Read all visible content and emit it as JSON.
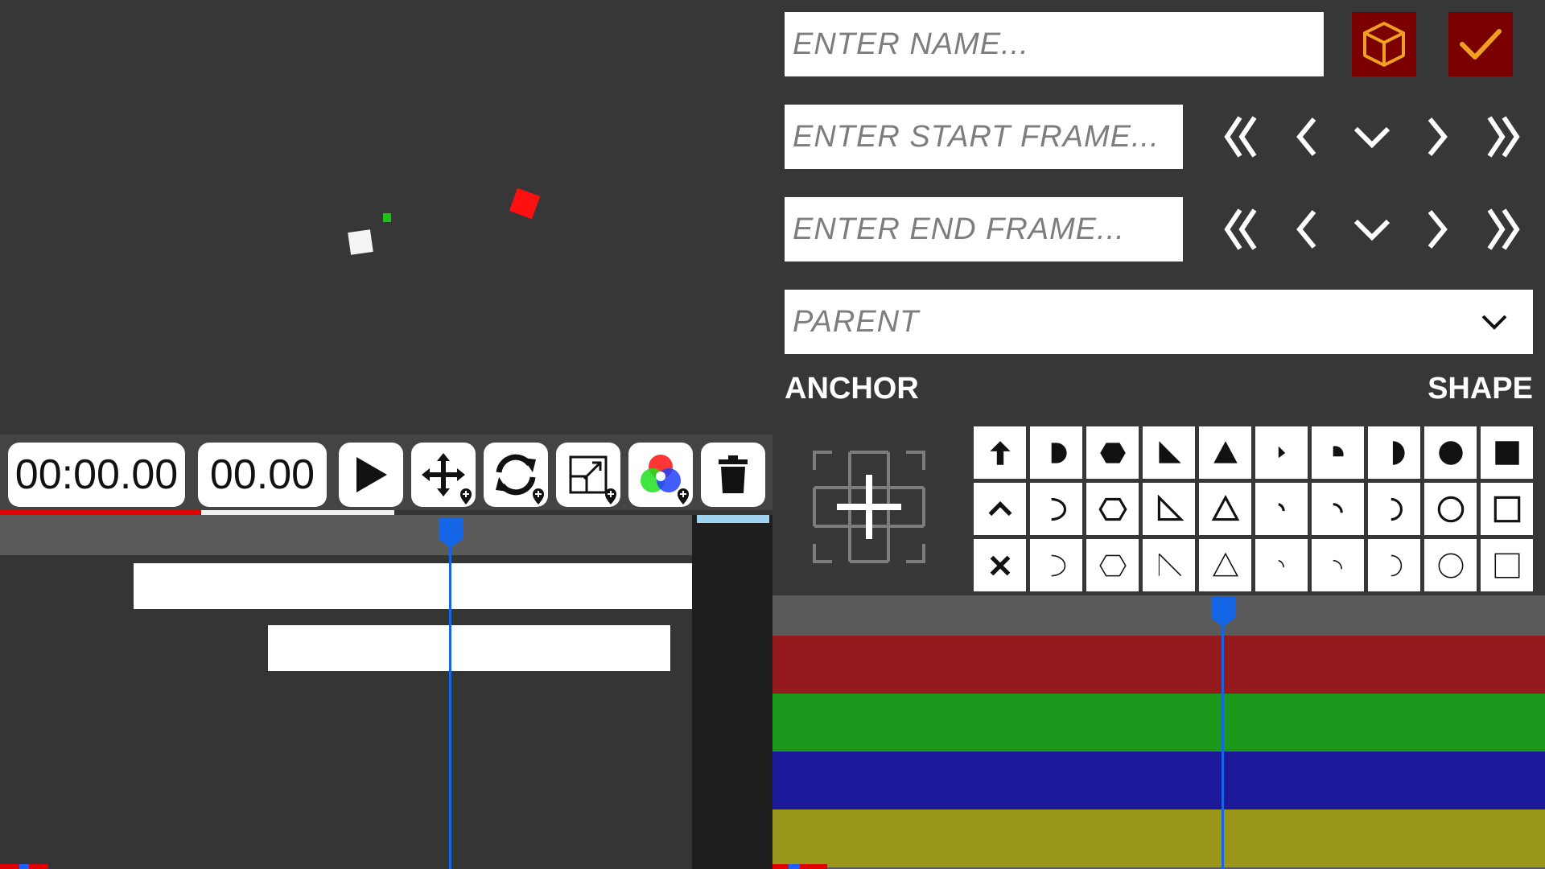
{
  "time": {
    "timecode": "00:00.00",
    "frame": "00.00"
  },
  "toolbar": {
    "buttons": [
      "play",
      "move-keyframe",
      "rotate-keyframe",
      "scale-keyframe",
      "color-keyframe",
      "delete"
    ]
  },
  "fields": {
    "name_placeholder": "ENTER NAME...",
    "start_frame_placeholder": "ENTER START FRAME...",
    "end_frame_placeholder": "ENTER END FRAME...",
    "parent_label": "PARENT"
  },
  "labels": {
    "anchor": "ANCHOR",
    "shape": "SHAPE"
  },
  "progress": {
    "fraction": 0.51
  },
  "colors": {
    "accent_button": "#7a0000",
    "accent_icon": "#f0a020",
    "playhead": "#1466e6",
    "track_red": "#951a1d",
    "track_green": "#1b981c",
    "track_blue": "#1b1899",
    "track_yellow": "#9a961b"
  }
}
